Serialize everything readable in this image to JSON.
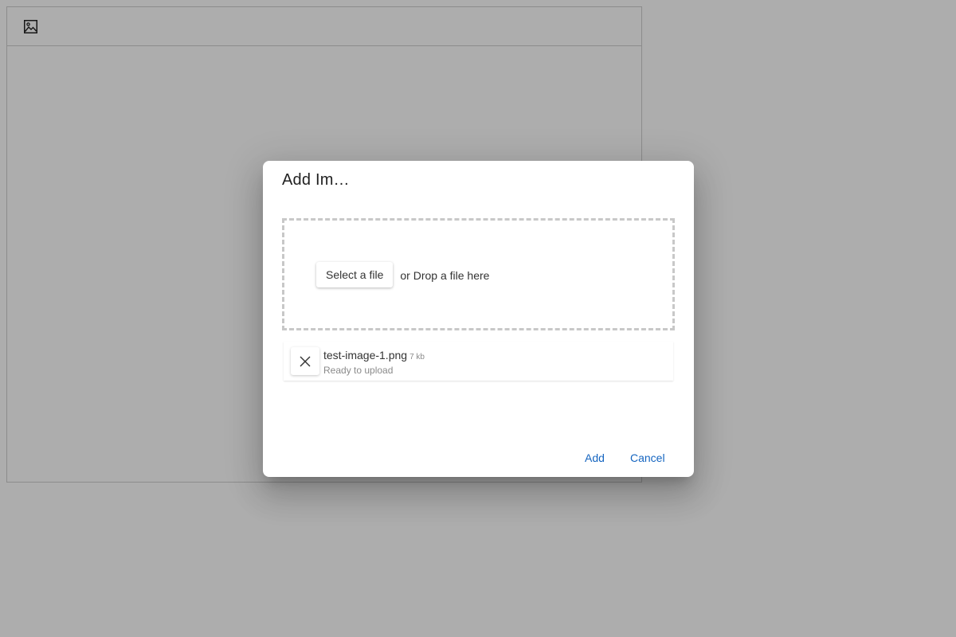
{
  "editor": {
    "toolbar": {
      "image_button_icon": "image-icon"
    }
  },
  "dialog": {
    "title": "Add Im…",
    "dropzone": {
      "select_label": "Select a file",
      "drop_label": "or Drop a file here"
    },
    "files": [
      {
        "name": "test-image-1.png",
        "size": "7 kb",
        "status": "Ready to upload",
        "remove_icon": "close-icon"
      }
    ],
    "actions": {
      "add_label": "Add",
      "cancel_label": "Cancel"
    }
  },
  "colors": {
    "accent": "#1565c0",
    "overlay": "rgba(0,0,0,0.32)",
    "text": "#333333",
    "muted": "#8a8a8a",
    "dropzone_border": "#c8c8c8"
  }
}
